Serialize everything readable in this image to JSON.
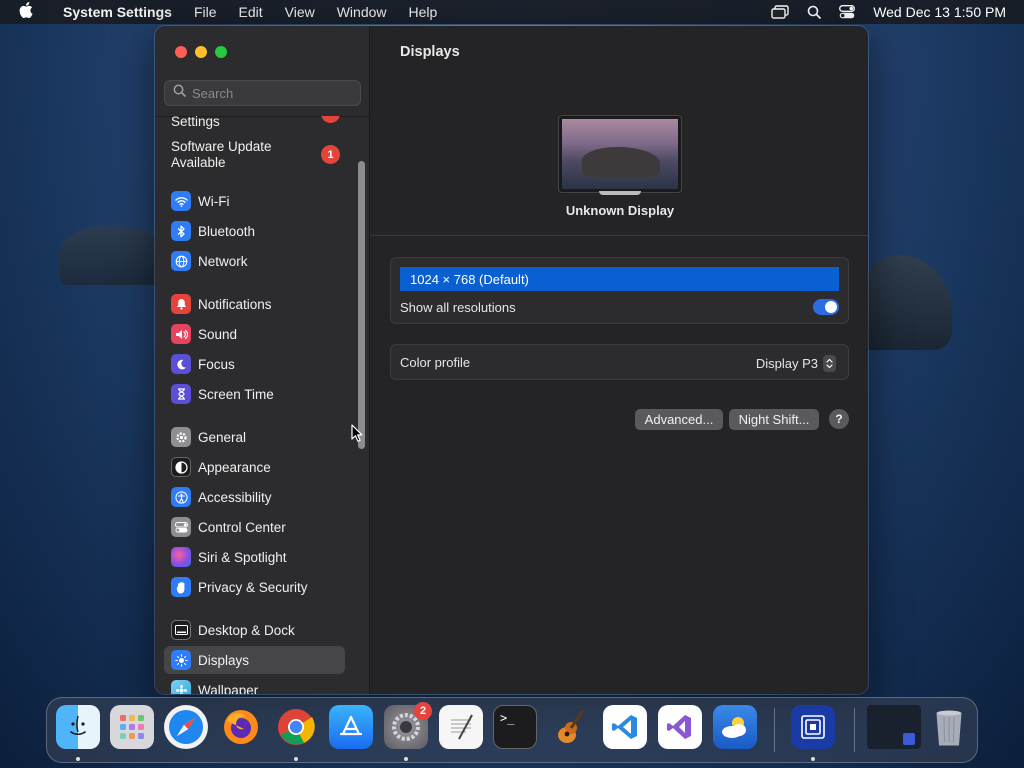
{
  "menubar": {
    "app_name": "System Settings",
    "menus": [
      "File",
      "Edit",
      "View",
      "Window",
      "Help"
    ],
    "clock": "Wed Dec 13  1:50 PM"
  },
  "window": {
    "search_placeholder": "Search",
    "sidebar": {
      "top_partial_label": "Settings",
      "software_update_line1": "Software Update",
      "software_update_line2": "Available",
      "software_update_badge": "1",
      "items": [
        {
          "label": "Wi-Fi",
          "icon": "wifi-icon",
          "color": "#2f7df6"
        },
        {
          "label": "Bluetooth",
          "icon": "bluetooth-icon",
          "color": "#2f7df6"
        },
        {
          "label": "Network",
          "icon": "globe-icon",
          "color": "#2f7df6"
        },
        {
          "label": "Notifications",
          "icon": "bell-icon",
          "color": "#e5443c"
        },
        {
          "label": "Sound",
          "icon": "speaker-icon",
          "color": "#e5445c"
        },
        {
          "label": "Focus",
          "icon": "moon-icon",
          "color": "#5b4fd6"
        },
        {
          "label": "Screen Time",
          "icon": "hourglass-icon",
          "color": "#5b4fd6"
        },
        {
          "label": "General",
          "icon": "gear-icon",
          "color": "#8e8e93"
        },
        {
          "label": "Appearance",
          "icon": "appearance-icon",
          "color": "#1c1c1e"
        },
        {
          "label": "Accessibility",
          "icon": "accessibility-icon",
          "color": "#2f7df6"
        },
        {
          "label": "Control Center",
          "icon": "control-center-icon",
          "color": "#8e8e93"
        },
        {
          "label": "Siri & Spotlight",
          "icon": "siri-icon",
          "color": "#b04fd6"
        },
        {
          "label": "Privacy & Security",
          "icon": "hand-icon",
          "color": "#2f7df6"
        },
        {
          "label": "Desktop & Dock",
          "icon": "dock-icon",
          "color": "#1c1c1e"
        },
        {
          "label": "Displays",
          "icon": "sun-icon",
          "color": "#2f7df6"
        },
        {
          "label": "Wallpaper",
          "icon": "wallpaper-icon",
          "color": "#34aadc"
        }
      ],
      "selected": "Displays"
    },
    "content": {
      "title": "Displays",
      "display_name": "Unknown Display",
      "resolution_selected": "1024 × 768 (Default)",
      "show_all_resolutions_label": "Show all resolutions",
      "show_all_resolutions_on": true,
      "color_profile_label": "Color profile",
      "color_profile_value": "Display P3",
      "advanced_button": "Advanced...",
      "night_shift_button": "Night Shift...",
      "help_button": "?"
    }
  },
  "dock": {
    "apps": [
      {
        "name": "Finder",
        "icon": "finder-icon",
        "running": true
      },
      {
        "name": "Launchpad",
        "icon": "launchpad-icon",
        "running": false
      },
      {
        "name": "Safari",
        "icon": "safari-icon",
        "running": false
      },
      {
        "name": "Firefox",
        "icon": "firefox-icon",
        "running": false
      },
      {
        "name": "Chrome",
        "icon": "chrome-icon",
        "running": true
      },
      {
        "name": "App Store",
        "icon": "app-store-icon",
        "running": false
      },
      {
        "name": "System Settings",
        "icon": "system-settings-icon",
        "running": true,
        "badge": "2"
      },
      {
        "name": "TextEdit",
        "icon": "textedit-icon",
        "running": false
      },
      {
        "name": "Terminal",
        "icon": "terminal-icon",
        "running": false
      },
      {
        "name": "GarageBand",
        "icon": "garageband-icon",
        "running": false
      },
      {
        "name": "VS Code",
        "icon": "vscode-icon",
        "running": false
      },
      {
        "name": "Visual Studio",
        "icon": "visual-studio-icon",
        "running": false
      },
      {
        "name": "Weather",
        "icon": "weather-icon",
        "running": false
      },
      {
        "name": "Screen App",
        "icon": "screen-app-icon",
        "running": true
      }
    ]
  }
}
